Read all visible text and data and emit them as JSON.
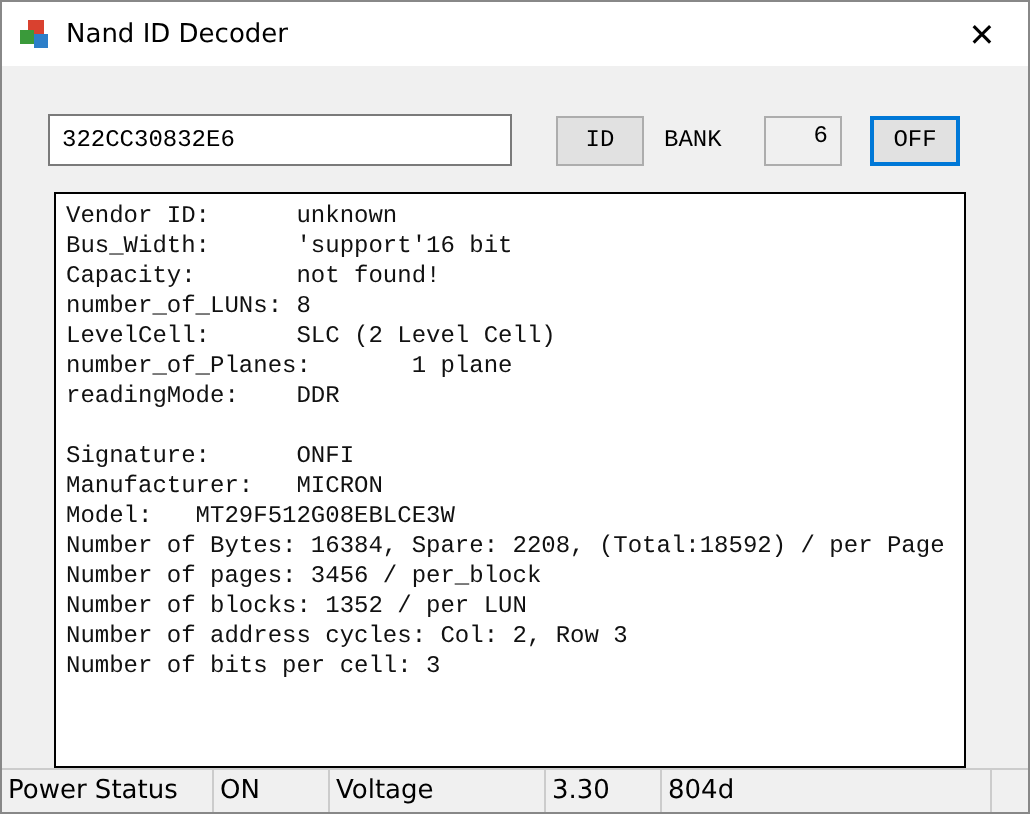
{
  "window": {
    "title": "Nand ID Decoder",
    "close": "✕"
  },
  "toolbar": {
    "id_input": "322CC30832E6",
    "id_button": "ID",
    "bank_label": "BANK",
    "bank_value": "6",
    "power_button": {
      "label": "OFF",
      "focused": true
    }
  },
  "output": {
    "groups": [
      [
        "Vendor ID:      unknown",
        "Bus_Width:      'support'16 bit",
        "Capacity:       not found!",
        "number_of_LUNs: 8",
        "LevelCell:      SLC (2 Level Cell)",
        "number_of_Planes:       1 plane",
        "readingMode:    DDR"
      ],
      [
        "Signature:      ONFI",
        "Manufacturer:   MICRON",
        "Model:   MT29F512G08EBLCE3W",
        "Number of Bytes: 16384, Spare: 2208, (Total:18592) / per Page",
        "Number of pages: 3456 / per_block",
        "Number of blocks: 1352 / per LUN",
        "Number of address cycles: Col: 2, Row 3",
        "Number of bits per cell: 3"
      ]
    ]
  },
  "status_bar": [
    "Power Status",
    "ON",
    "Voltage",
    "3.30",
    "804d"
  ]
}
